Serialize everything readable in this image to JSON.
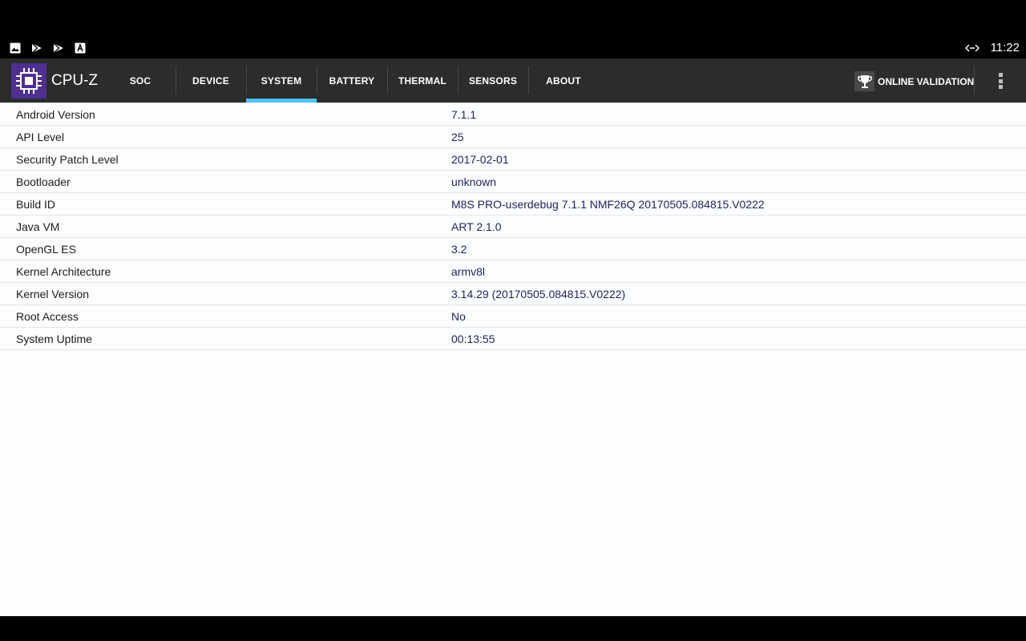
{
  "status_bar": {
    "left_icons": [
      "image-icon",
      "play-store-icon",
      "play-store-icon",
      "font-icon"
    ],
    "right_icons": [
      "network-arrows-icon"
    ],
    "clock": "11:22"
  },
  "app": {
    "title": "CPU-Z",
    "tabs": [
      {
        "label": "SOC",
        "active": false
      },
      {
        "label": "DEVICE",
        "active": false
      },
      {
        "label": "SYSTEM",
        "active": true
      },
      {
        "label": "BATTERY",
        "active": false
      },
      {
        "label": "THERMAL",
        "active": false
      },
      {
        "label": "SENSORS",
        "active": false
      },
      {
        "label": "ABOUT",
        "active": false
      }
    ],
    "validation_label": "ONLINE VALIDATION"
  },
  "system": {
    "rows": [
      {
        "label": "Android Version",
        "value": "7.1.1"
      },
      {
        "label": "API Level",
        "value": "25"
      },
      {
        "label": "Security Patch Level",
        "value": "2017-02-01"
      },
      {
        "label": "Bootloader",
        "value": "unknown"
      },
      {
        "label": "Build ID",
        "value": "M8S PRO-userdebug 7.1.1 NMF26Q 20170505.084815.V0222"
      },
      {
        "label": "Java VM",
        "value": "ART 2.1.0"
      },
      {
        "label": "OpenGL ES",
        "value": "3.2"
      },
      {
        "label": "Kernel Architecture",
        "value": "armv8l"
      },
      {
        "label": "Kernel Version",
        "value": "3.14.29 (20170505.084815.V0222)"
      },
      {
        "label": "Root Access",
        "value": "No"
      },
      {
        "label": "System Uptime",
        "value": "00:13:55"
      }
    ]
  },
  "colors": {
    "appbar": "#2b2c2e",
    "tab_indicator": "#4fc3f7",
    "logo_bg": "#4f2f8f",
    "value_text": "#1d2357"
  }
}
